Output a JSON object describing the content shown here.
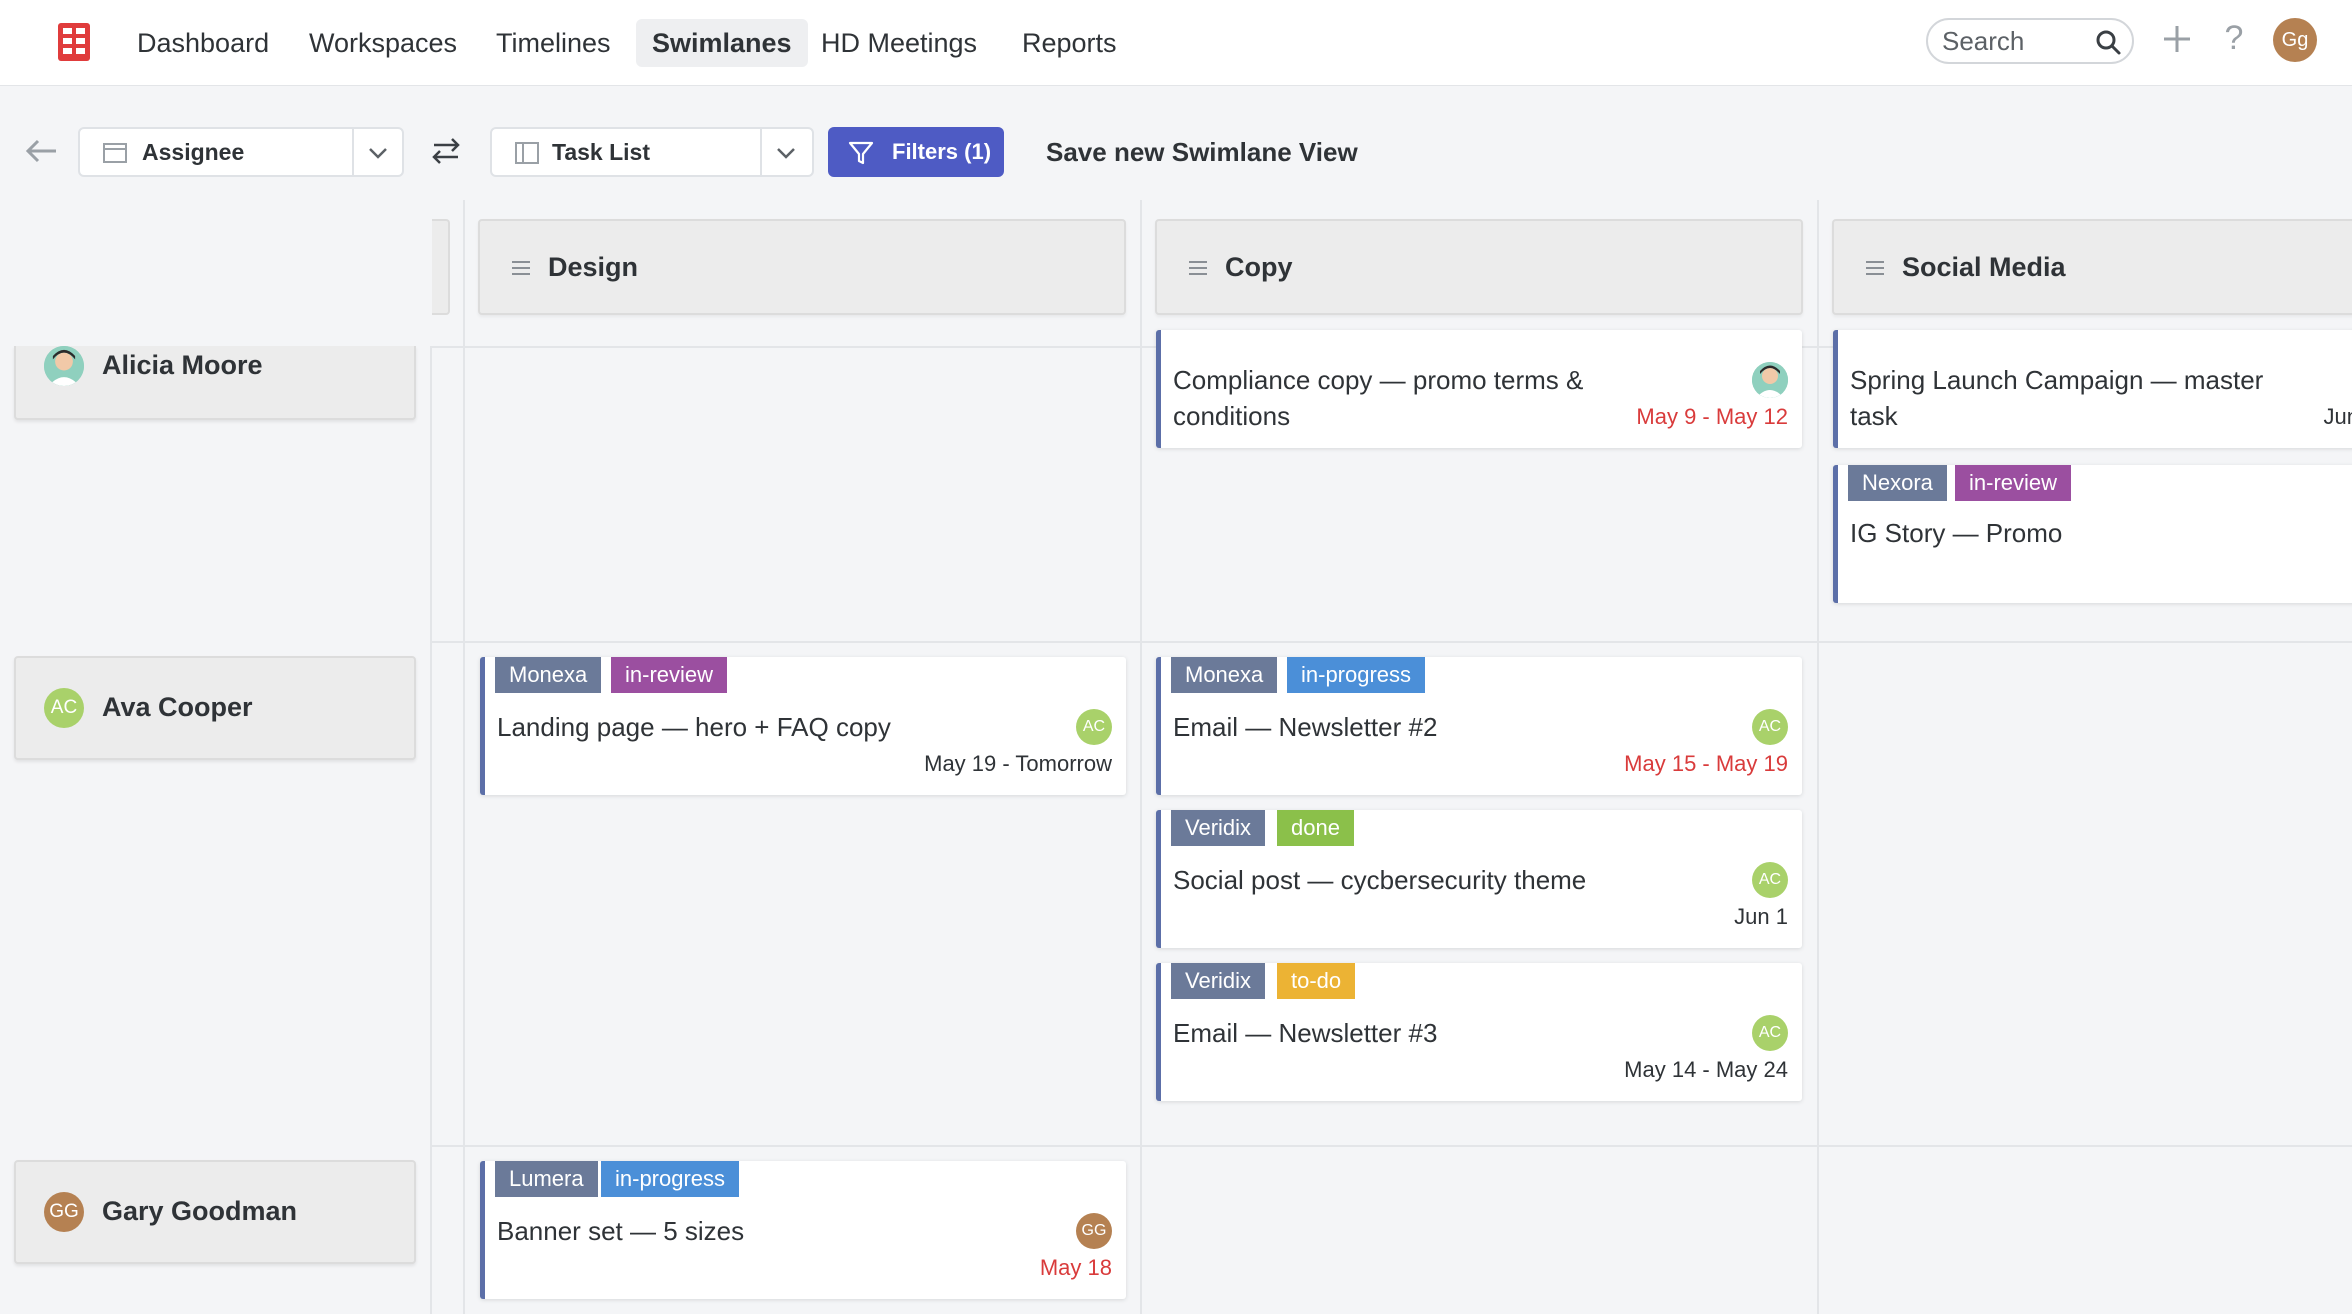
{
  "nav": {
    "items": [
      "Dashboard",
      "Workspaces",
      "Timelines",
      "Swimlanes",
      "HD Meetings",
      "Reports"
    ],
    "active": "Swimlanes",
    "search_placeholder": "Search",
    "user_initials": "Gg"
  },
  "toolbar": {
    "group_by": "Assignee",
    "view_type": "Task List",
    "filters_label": "Filters (1)",
    "save_view_label": "Save new Swimlane View"
  },
  "columns": [
    "Design",
    "Copy",
    "Social Media"
  ],
  "rows": [
    {
      "name": "Alicia Moore",
      "initials": ""
    },
    {
      "name": "Ava Cooper",
      "initials": "AC"
    },
    {
      "name": "Gary Goodman",
      "initials": "GG"
    }
  ],
  "cards": {
    "alicia_copy": {
      "title": "Compliance copy — promo terms & conditions",
      "date": "May 9 - May 12"
    },
    "alicia_social_1": {
      "title": "Spring Launch Campaign — master task",
      "date": "Jun"
    },
    "alicia_social_2": {
      "client": "Nexora",
      "status": "in-review",
      "title": "IG Story — Promo"
    },
    "ava_design": {
      "client": "Monexa",
      "status": "in-review",
      "title": "Landing page — hero + FAQ copy",
      "assignee": "AC",
      "date": "May 19 - Tomorrow"
    },
    "ava_copy_1": {
      "client": "Monexa",
      "status": "in-progress",
      "title": "Email — Newsletter #2",
      "assignee": "AC",
      "date": "May 15 - May 19"
    },
    "ava_copy_2": {
      "client": "Veridix",
      "status": "done",
      "title": "Social post — cycbersecurity theme",
      "assignee": "AC",
      "date": "Jun 1"
    },
    "ava_copy_3": {
      "client": "Veridix",
      "status": "to-do",
      "title": "Email — Newsletter #3",
      "assignee": "AC",
      "date": "May 14 - May 24"
    },
    "gary_design": {
      "client": "Lumera",
      "status": "in-progress",
      "title": "Banner set — 5 sizes",
      "assignee": "GG",
      "date": "May 18"
    }
  },
  "colors": {
    "accent": "#4e5bc4",
    "overdue": "#d93b3b",
    "status_in_review": "#9b4fa0",
    "status_in_progress": "#4b8fd8",
    "status_done": "#8bc04a",
    "status_to_do": "#ecb334",
    "client_tag": "#6b7a99",
    "logo": "#e03c3c"
  }
}
